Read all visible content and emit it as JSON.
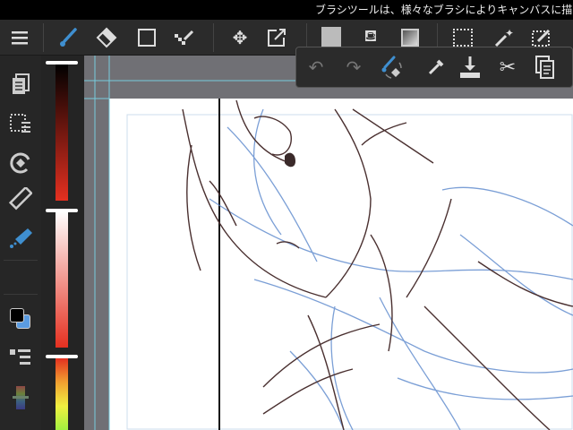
{
  "status": {
    "message": "ブラシツールは、様々なブラシによりキャンバスに描画を"
  },
  "toolbar": {
    "tools": [
      "menu",
      "brush",
      "eraser",
      "shape",
      "dot-select",
      "move",
      "transform",
      "fill-color",
      "bucket",
      "gradient",
      "select-rect",
      "magic-wand",
      "select-pen"
    ]
  },
  "popup": {
    "tools": [
      "undo",
      "redo",
      "brush-swap",
      "eyedropper",
      "save",
      "cut",
      "copy"
    ]
  },
  "sidebar": {
    "items": [
      "layers",
      "selection-layers",
      "rotate",
      "ruler",
      "brush-size",
      "colors",
      "brush-list",
      "palette"
    ]
  },
  "colors": {
    "accent": "#3f8fd0",
    "foreground": "#000000",
    "background": "#5a9be0",
    "hue_fraction": 0.0,
    "saturation_fraction": 1.0,
    "brightness_fraction": 1.0
  }
}
